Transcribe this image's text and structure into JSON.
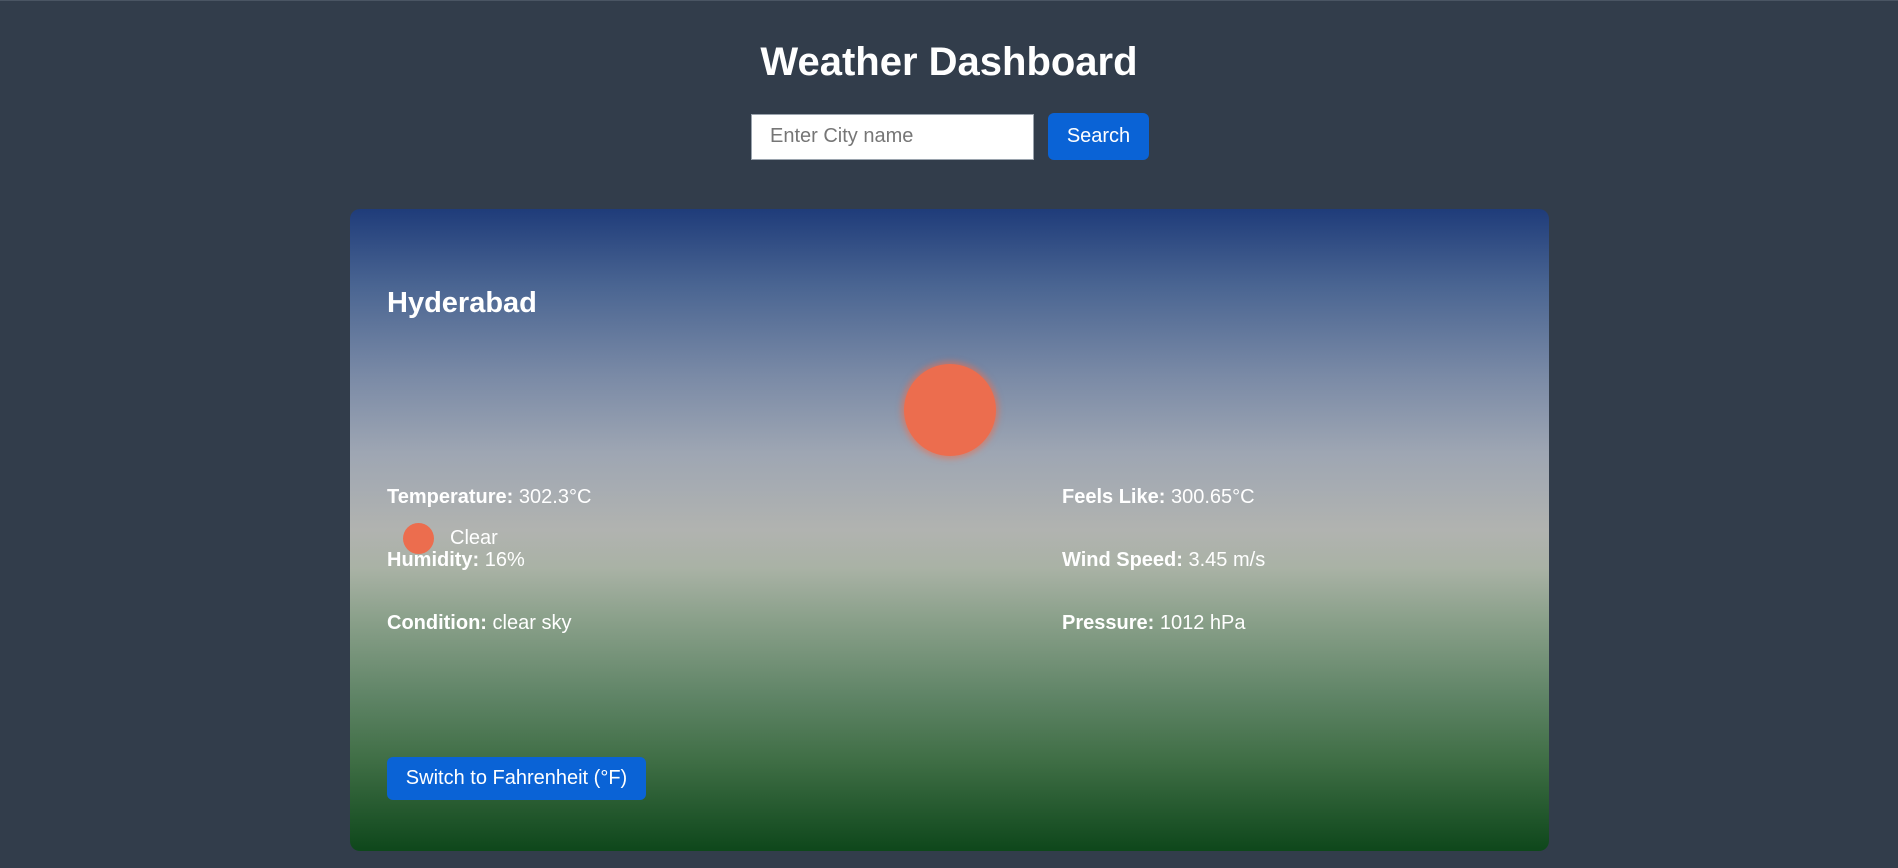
{
  "header": {
    "title": "Weather Dashboard"
  },
  "search": {
    "placeholder": "Enter City name",
    "value": "",
    "button_label": "Search"
  },
  "weather": {
    "city": "Hyderabad",
    "icon": "sun-icon",
    "condition_short": "Clear",
    "condition_icon": "sun-dot-icon",
    "stats": {
      "temperature": {
        "label": "Temperature:",
        "value": "302.3°C"
      },
      "feels_like": {
        "label": "Feels Like:",
        "value": "300.65°C"
      },
      "humidity": {
        "label": "Humidity:",
        "value": "16%"
      },
      "wind_speed": {
        "label": "Wind Speed:",
        "value": "3.45 m/s"
      },
      "condition": {
        "label": "Condition:",
        "value": "clear sky"
      },
      "pressure": {
        "label": "Pressure:",
        "value": "1012 hPa"
      }
    },
    "unit_toggle_label": "Switch to Fahrenheit (°F)"
  },
  "colors": {
    "page_background": "#323d4b",
    "accent_button": "#0a63d6",
    "sun": "#ec6d4e",
    "card_gradient_top": "#1f3c7a",
    "card_gradient_bottom": "#0e471b"
  }
}
